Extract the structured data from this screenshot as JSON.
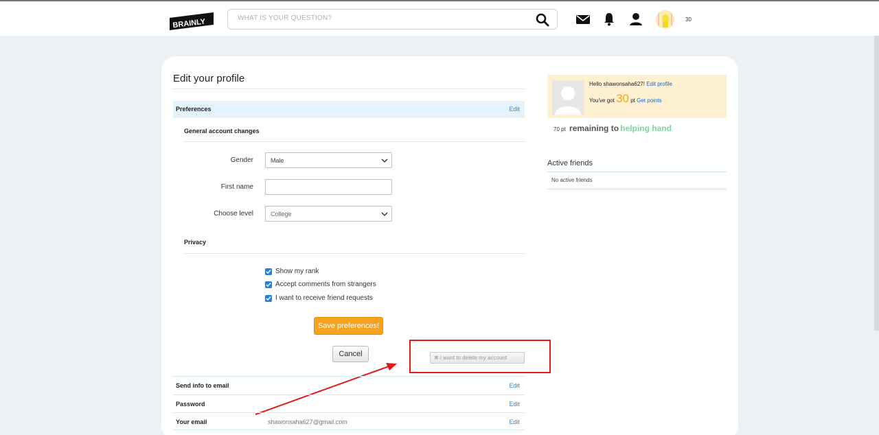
{
  "header": {
    "logo_text": "BRAINLY",
    "search_placeholder": "WHAT IS YOUR QUESTION?",
    "points": "30",
    "icons": [
      "search-icon",
      "mail-icon",
      "bell-icon",
      "user-icon",
      "avatar"
    ]
  },
  "main": {
    "title": "Edit your profile",
    "preferences": {
      "label": "Preferences",
      "edit": "Edit"
    },
    "general": {
      "title": "General account changes",
      "gender_label": "Gender",
      "gender_value": "Male",
      "first_name_label": "First name",
      "first_name_value": "",
      "level_label": "Choose level",
      "level_value": "College"
    },
    "privacy": {
      "title": "Privacy",
      "options": [
        {
          "label": "Show my rank",
          "checked": true
        },
        {
          "label": "Accept comments from strangers",
          "checked": true
        },
        {
          "label": "I want to receive friend requests",
          "checked": true
        }
      ]
    },
    "save_label": "Save preferences!",
    "cancel_label": "Cancel",
    "delete_label": "I want to delete my account",
    "rows": [
      {
        "label": "Send info to email",
        "value": "",
        "edit": "Edit"
      },
      {
        "label": "Password",
        "value": "",
        "edit": "Edit"
      },
      {
        "label": "Your email",
        "value": "shawonsaha627@gmail.com",
        "edit": "Edit"
      }
    ]
  },
  "sidebar": {
    "hello_prefix": "Hello shawonsaha627!",
    "edit_profile": "Edit profile",
    "got_prefix": "You've got",
    "points": "30",
    "pt": "pt",
    "get_points": "Get points",
    "remaining_pts": "70 pt",
    "remaining_text": "remaining to",
    "helping_hand": "helping hand",
    "active_friends_title": "Active friends",
    "no_friends": "No active friends"
  },
  "colors": {
    "accent_orange": "#f7a21f",
    "link_blue": "#3b84c4",
    "highlight_red": "#e01a1a",
    "pref_bar": "#e6f3fb"
  }
}
